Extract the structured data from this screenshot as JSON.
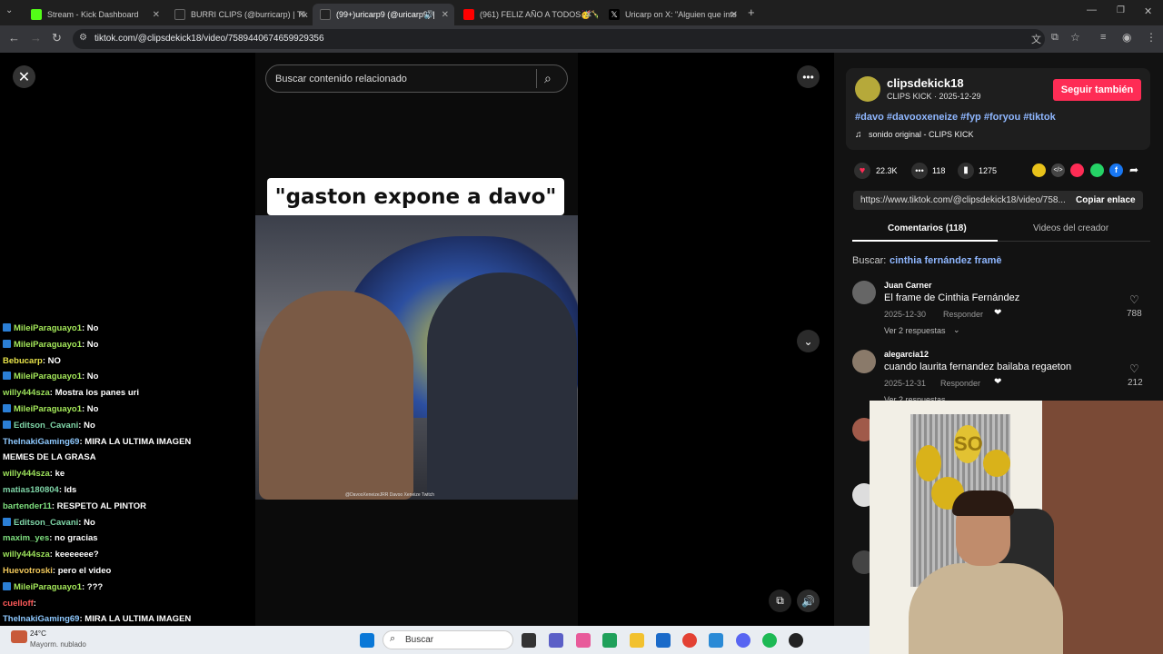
{
  "browser": {
    "tabs": [
      {
        "title": "Stream - Kick Dashboard",
        "color": "#53fc18"
      },
      {
        "title": "BURRI CLIPS (@burricarp) | Tik",
        "color": "#111111"
      },
      {
        "title": "(99+)uricarp9 (@uricarp9) |",
        "color": "#111111"
      },
      {
        "title": "(961) FELIZ AÑO A TODOS🥳🍾",
        "color": "#ff0000"
      },
      {
        "title": "Uricarp on X: \"Alguien que inte",
        "color": "#000000"
      }
    ],
    "url": "tiktok.com/@clipsdekick18/video/7589440674659929356"
  },
  "player": {
    "search_placeholder": "Buscar contenido relacionado",
    "caption": "\"gaston expone a davo\"",
    "watermark": "@DavooXeneizeJRR   Davoo Xeneize Twitch"
  },
  "video_info": {
    "username": "clipsdekick18",
    "subtitle": "CLIPS KICK · 2025-12-29",
    "follow_label": "Seguir también",
    "hashtags": "#davo #davooxeneize #fyp #foryou #tiktok",
    "sound": "sonido original - CLIPS KICK",
    "likes": "22.3K",
    "comments": "118",
    "saves": "1275",
    "link": "https://www.tiktok.com/@clipsdekick18/video/758...",
    "copy_label": "Copiar enlace",
    "tab_comments": "Comentarios (118)",
    "tab_creator": "Videos del creador",
    "search_label": "Buscar:",
    "search_suggestion": "cinthia fernández frame"
  },
  "comments": [
    {
      "user": "Juan Carner",
      "text": "El frame de Cinthia Fernández",
      "date": "2025-12-30",
      "reply": "Responder",
      "likes": "788",
      "replies": "Ver 2 respuestas"
    },
    {
      "user": "alegarcia12",
      "text": "cuando laurita fernandez bailaba regaeton",
      "date": "2025-12-31",
      "reply": "Responder",
      "likes": "212",
      "replies": "Ver 2 respuestas"
    }
  ],
  "chat": [
    {
      "badge": true,
      "user": "MileiParaguayo1",
      "color": "#a4e85a",
      "msg": ": No"
    },
    {
      "badge": true,
      "user": "MileiParaguayo1",
      "color": "#a4e85a",
      "msg": ": No"
    },
    {
      "badge": false,
      "user": "Bebucarp",
      "color": "#e8e34a",
      "msg": ": NO"
    },
    {
      "badge": true,
      "user": "MileiParaguayo1",
      "color": "#a4e85a",
      "msg": ": No"
    },
    {
      "badge": false,
      "user": "willy444sza",
      "color": "#9be05a",
      "msg": ": Mostra los panes uri"
    },
    {
      "badge": true,
      "user": "MileiParaguayo1",
      "color": "#a4e85a",
      "msg": ": No"
    },
    {
      "badge": true,
      "user": "Editson_Cavani",
      "color": "#7fd6a8",
      "msg": ": No"
    },
    {
      "badge": false,
      "user": "TheInakiGaming69",
      "color": "#8ec9ff",
      "msg": ": MIRA LA ULTIMA IMAGEN MEMES DE LA GRASA"
    },
    {
      "badge": false,
      "user": "willy444sza",
      "color": "#9be05a",
      "msg": ": ke"
    },
    {
      "badge": false,
      "user": "matias180804",
      "color": "#7fd6a8",
      "msg": ": lds"
    },
    {
      "badge": false,
      "user": "bartender11",
      "color": "#7fe07f",
      "msg": ": RESPETO AL PINTOR"
    },
    {
      "badge": true,
      "user": "Editson_Cavani",
      "color": "#7fd6a8",
      "msg": ": No"
    },
    {
      "badge": false,
      "user": "maxim_yes",
      "color": "#7fe07f",
      "msg": ": no gracias"
    },
    {
      "badge": false,
      "user": "willy444sza",
      "color": "#9be05a",
      "msg": ": keeeeeee?"
    },
    {
      "badge": false,
      "user": "Huevotroski",
      "color": "#f0c75a",
      "msg": ": pero el video"
    },
    {
      "badge": true,
      "user": "MileiParaguayo1",
      "color": "#a4e85a",
      "msg": ": ???"
    },
    {
      "badge": false,
      "user": "cuelloff",
      "color": "#ff5a5a",
      "msg": ":"
    },
    {
      "badge": false,
      "user": "TheInakiGaming69",
      "color": "#8ec9ff",
      "msg": ": MIRA LA ULTIMA IMAGEN MEMES DE LA GRASA"
    }
  ],
  "taskbar": {
    "search": "Buscar",
    "weather_temp": "24°C",
    "weather_text": "Mayorm. nublado"
  },
  "overlay": {
    "balloon_text": "SO"
  }
}
